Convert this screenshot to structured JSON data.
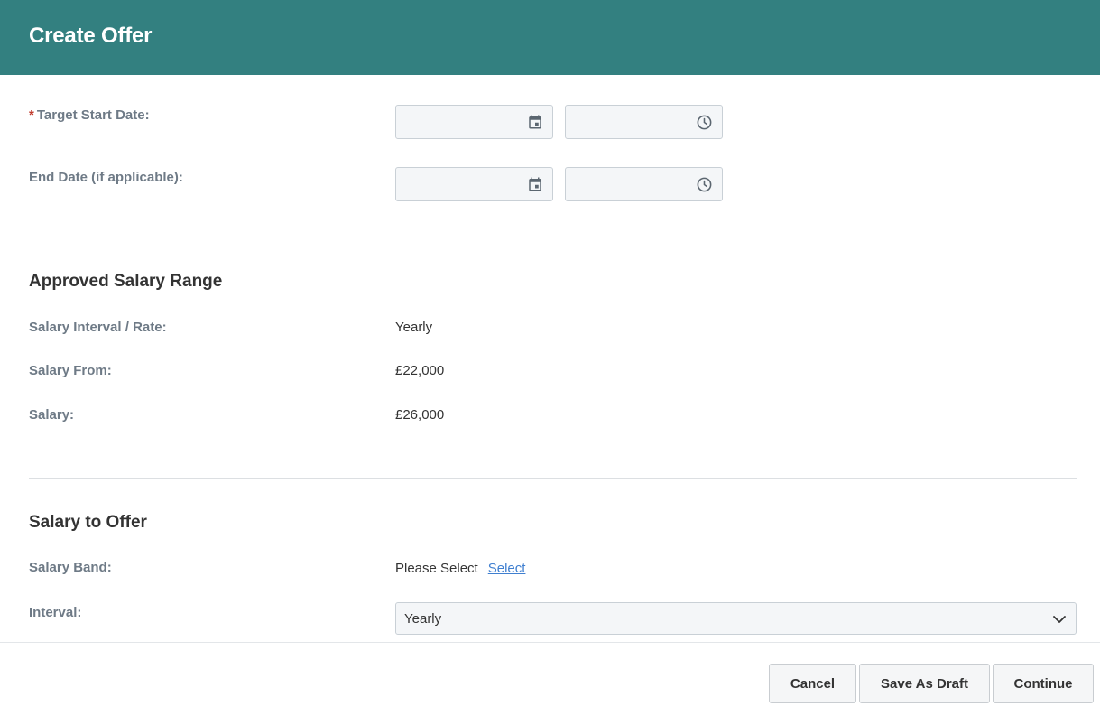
{
  "header": {
    "title": "Create Offer"
  },
  "dates": {
    "target_start": {
      "required_mark": "*",
      "label": "Target Start Date:"
    },
    "end_date": {
      "label": "End Date (if applicable):"
    }
  },
  "approved_range": {
    "title": "Approved Salary Range",
    "rows": [
      {
        "label": "Salary Interval / Rate:",
        "value": "Yearly"
      },
      {
        "label": "Salary From:",
        "value": "£22,000"
      },
      {
        "label": "Salary:",
        "value": "£26,000"
      }
    ]
  },
  "offer": {
    "title": "Salary to Offer",
    "band_label": "Salary Band:",
    "band_value": "Please Select",
    "band_link": "Select",
    "interval_label": "Interval:",
    "interval_value": "Yearly"
  },
  "footer": {
    "cancel": "Cancel",
    "save_draft": "Save As Draft",
    "continue": "Continue"
  },
  "icons": {
    "date": "calendar-icon",
    "time": "clock-icon",
    "dropdown": "chevron-down-icon"
  },
  "colors": {
    "header_bg": "#338080",
    "link": "#3f7fd0",
    "required": "#c0392b"
  }
}
